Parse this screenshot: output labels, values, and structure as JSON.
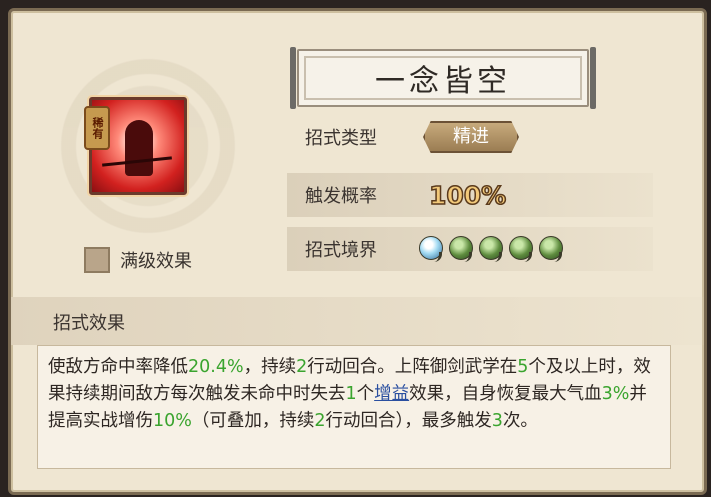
{
  "skill": {
    "title": "一念皆空",
    "rarity_badge": "稀有",
    "max_level_label": "满级效果"
  },
  "stats": {
    "type_label": "招式类型",
    "type_value": "精进",
    "trigger_label": "触发概率",
    "trigger_value": "100%",
    "realm_label": "招式境界",
    "realm_level": 1,
    "realm_max": 5
  },
  "effect": {
    "section_title": "招式效果",
    "parts": [
      {
        "t": "使敌方命中率降低"
      },
      {
        "t": "20.4%",
        "s": "g"
      },
      {
        "t": "，持续"
      },
      {
        "t": "2",
        "s": "g"
      },
      {
        "t": "行动回合。上阵御剑武学在"
      },
      {
        "t": "5",
        "s": "g"
      },
      {
        "t": "个及以上时，效果持续期间敌方每次触发未命中时失去"
      },
      {
        "t": "1",
        "s": "g"
      },
      {
        "t": "个"
      },
      {
        "t": "增益",
        "s": "link"
      },
      {
        "t": "效果，自身恢复最大气血"
      },
      {
        "t": "3%",
        "s": "g"
      },
      {
        "t": "并提高实战增伤"
      },
      {
        "t": "10%",
        "s": "g"
      },
      {
        "t": "（可叠加，持续"
      },
      {
        "t": "2",
        "s": "g"
      },
      {
        "t": "行动回合），最多触发"
      },
      {
        "t": "3",
        "s": "g"
      },
      {
        "t": "次。"
      }
    ]
  },
  "colors": {
    "highlight": "#3aa42e",
    "link": "#2a4fa0",
    "panel": "#efe6d2"
  }
}
